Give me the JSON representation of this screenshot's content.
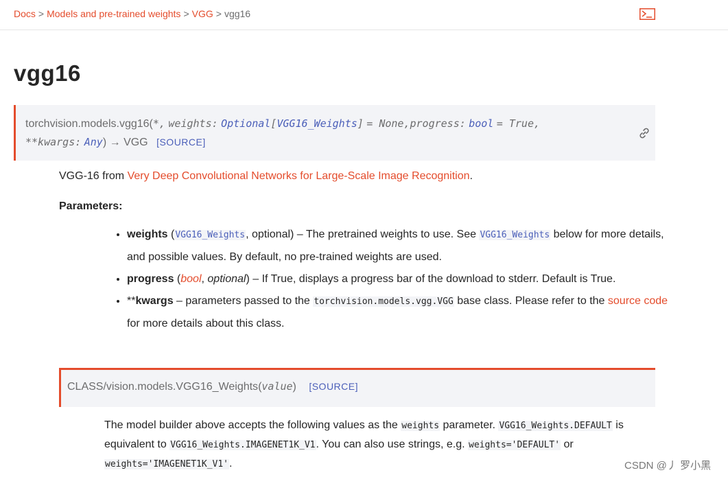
{
  "breadcrumb": {
    "items": [
      "Docs",
      "Models and pre-trained weights",
      "VGG"
    ],
    "current": "vgg16",
    "separator": ">"
  },
  "page_title": "vgg16",
  "signature": {
    "module": "torchvision.models.vgg16",
    "open_paren": "(",
    "star": "*,",
    "weights_param": "weights:",
    "optional_type": "Optional",
    "bracket_open": "[",
    "weights_type": "VGG16_Weights",
    "bracket_close": "]",
    "weights_default": "= None,",
    "progress_param": "progress:",
    "bool_type": "bool",
    "progress_default": "= True,",
    "kwargs_param": "**kwargs:",
    "any_type": "Any",
    "close_paren": ")",
    "arrow": "→",
    "return_type": "VGG",
    "source_label": "[SOURCE]"
  },
  "description": {
    "prefix": "VGG-16 from ",
    "link": "Very Deep Convolutional Networks for Large-Scale Image Recognition",
    "suffix": "."
  },
  "parameters_label": "Parameters:",
  "params": {
    "weights": {
      "name": "weights",
      "open": " (",
      "type": "VGG16_Weights",
      "type_suffix": ", optional) – ",
      "text1": "The pretrained weights to use. See ",
      "ref": "VGG16_Weights",
      "text2": " below for more details, and possible values. By default, no pre-trained weights are used."
    },
    "progress": {
      "name": "progress",
      "open": " (",
      "type": "bool",
      "comma": ", ",
      "optional": "optional",
      "close": ") – ",
      "text": "If True, displays a progress bar of the download to stderr. Default is True."
    },
    "kwargs": {
      "stars": "**",
      "name": "kwargs",
      "dash": " – ",
      "text1": "parameters passed to the ",
      "code": "torchvision.models.vgg.VGG",
      "text2": " base class. Please refer to the ",
      "link": "source code",
      "text3": " for more details about this class."
    }
  },
  "class_sig": {
    "name": "CLASS/vision.models.VGG16_Weights",
    "open": "(",
    "arg": "value",
    "close": ")",
    "source_label": "[SOURCE]"
  },
  "class_desc": {
    "t1": "The model builder above accepts the following values as the ",
    "c1": "weights",
    "t2": " parameter. ",
    "c2": "VGG16_Weights.DEFAULT",
    "t3": " is equivalent to ",
    "c3": "VGG16_Weights.IMAGENET1K_V1",
    "t4": ". You can also use strings, e.g. ",
    "c4": "weights='DEFAULT'",
    "t5": " or ",
    "c5": "weights='IMAGENET1K_V1'",
    "t6": "."
  },
  "watermark": "CSDN @丿 罗小黑",
  "colors": {
    "accent": "#e44c2c",
    "link_blue": "#4b5fb9",
    "code_bg": "#f3f4f7"
  },
  "icons": {
    "terminal": "terminal-icon",
    "permalink": "link-icon"
  }
}
